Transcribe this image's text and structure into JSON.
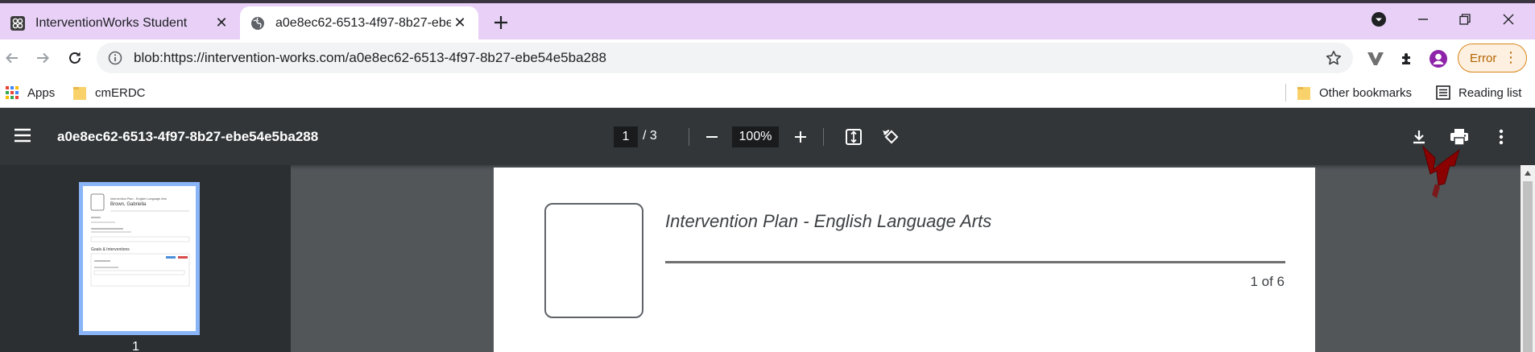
{
  "tabs": [
    {
      "title": "InterventionWorks Student",
      "active": false,
      "favicon": "interventionworks-logo-icon"
    },
    {
      "title": "a0e8ec62-6513-4f97-8b27-ebe54e5ba288",
      "active": true,
      "favicon": "globe-icon"
    }
  ],
  "address_bar": {
    "url": "blob:https://intervention-works.com/a0e8ec62-6513-4f97-8b27-ebe54e5ba288"
  },
  "profile_status": {
    "label": "Error"
  },
  "bookmarks": {
    "items": [
      {
        "label": "Apps",
        "icon": "apps-grid-icon"
      },
      {
        "label": "cmERDC",
        "icon": "folder-icon"
      }
    ],
    "other_bookmarks": "Other bookmarks",
    "reading_list": "Reading list"
  },
  "pdf": {
    "title": "a0e8ec62-6513-4f97-8b27-ebe54e5ba288",
    "current_page": "1",
    "page_total": "/  3",
    "zoom": "100%",
    "thumbnail_label": "1",
    "thumbnail": {
      "heading": "Intervention Plan - English Language Arts",
      "student": "Brown, Gabriella",
      "section": "Goals & Interventions"
    }
  },
  "page_content": {
    "plan_title": "Intervention Plan - English Language Arts",
    "page_count": "1 of 6"
  },
  "colors": {
    "tab_strip": "#e8d0f7",
    "pdf_toolbar": "#323639",
    "pdf_background": "#525659",
    "thumbnail_border": "#8ab4f8",
    "error_accent": "#d8861a",
    "annotation_arrow": "#8b0000"
  }
}
